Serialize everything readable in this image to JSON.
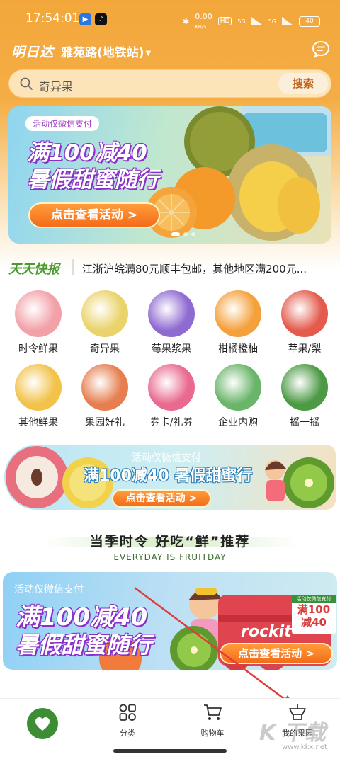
{
  "status_bar": {
    "time": "17:54:01",
    "network_speed": "0.00",
    "speed_unit": "KB/S",
    "hd": "HD",
    "signal1": "5G",
    "signal2": "5G",
    "battery": "40"
  },
  "header": {
    "logo": "明日达",
    "location": "雅苑路(地铁站)"
  },
  "search": {
    "placeholder": "奇异果",
    "button": "搜索"
  },
  "banner1": {
    "tag": "活动仅微信支付",
    "line1": "满100减40",
    "line2": "暑假甜蜜随行",
    "button": "点击查看活动 >"
  },
  "news": {
    "title": "天天快报",
    "text": "江浙沪皖满80元顺丰包邮，其他地区满200元..."
  },
  "categories": [
    {
      "label": "时令鲜果",
      "color": "#f2a1a8"
    },
    {
      "label": "奇异果",
      "color": "#e9d36a"
    },
    {
      "label": "莓果浆果",
      "color": "#8f6ad1"
    },
    {
      "label": "柑橘橙柚",
      "color": "#f4a13c"
    },
    {
      "label": "苹果/梨",
      "color": "#e45b4d"
    },
    {
      "label": "其他鲜果",
      "color": "#f2c24a"
    },
    {
      "label": "果园好礼",
      "color": "#e67e4f"
    },
    {
      "label": "券卡/礼券",
      "color": "#e96a8e"
    },
    {
      "label": "企业内购",
      "color": "#6bb56a"
    },
    {
      "label": "摇一摇",
      "color": "#4d9a45"
    }
  ],
  "banner2": {
    "tag": "活动仅微信支付",
    "title": "满100减40 暑假甜蜜行",
    "button": "点击查看活动 >"
  },
  "section": {
    "title": "当季时令 好吃“鲜”推荐",
    "subtitle": "EVERYDAY IS FRUITDAY"
  },
  "banner3": {
    "tag": "活动仅微信支付",
    "line1": "满100减40",
    "line2": "暑假甜蜜随行",
    "button": "点击查看活动 >",
    "brand": "rockit",
    "price_line1": "满100",
    "price_line2": "减40",
    "badge": "活动仅微信支付"
  },
  "tabbar": {
    "tab2": "分类",
    "tab3": "购物车",
    "tab4": "我的果园"
  },
  "watermark": {
    "logo": "K 下载",
    "url": "www.kkx.net"
  }
}
